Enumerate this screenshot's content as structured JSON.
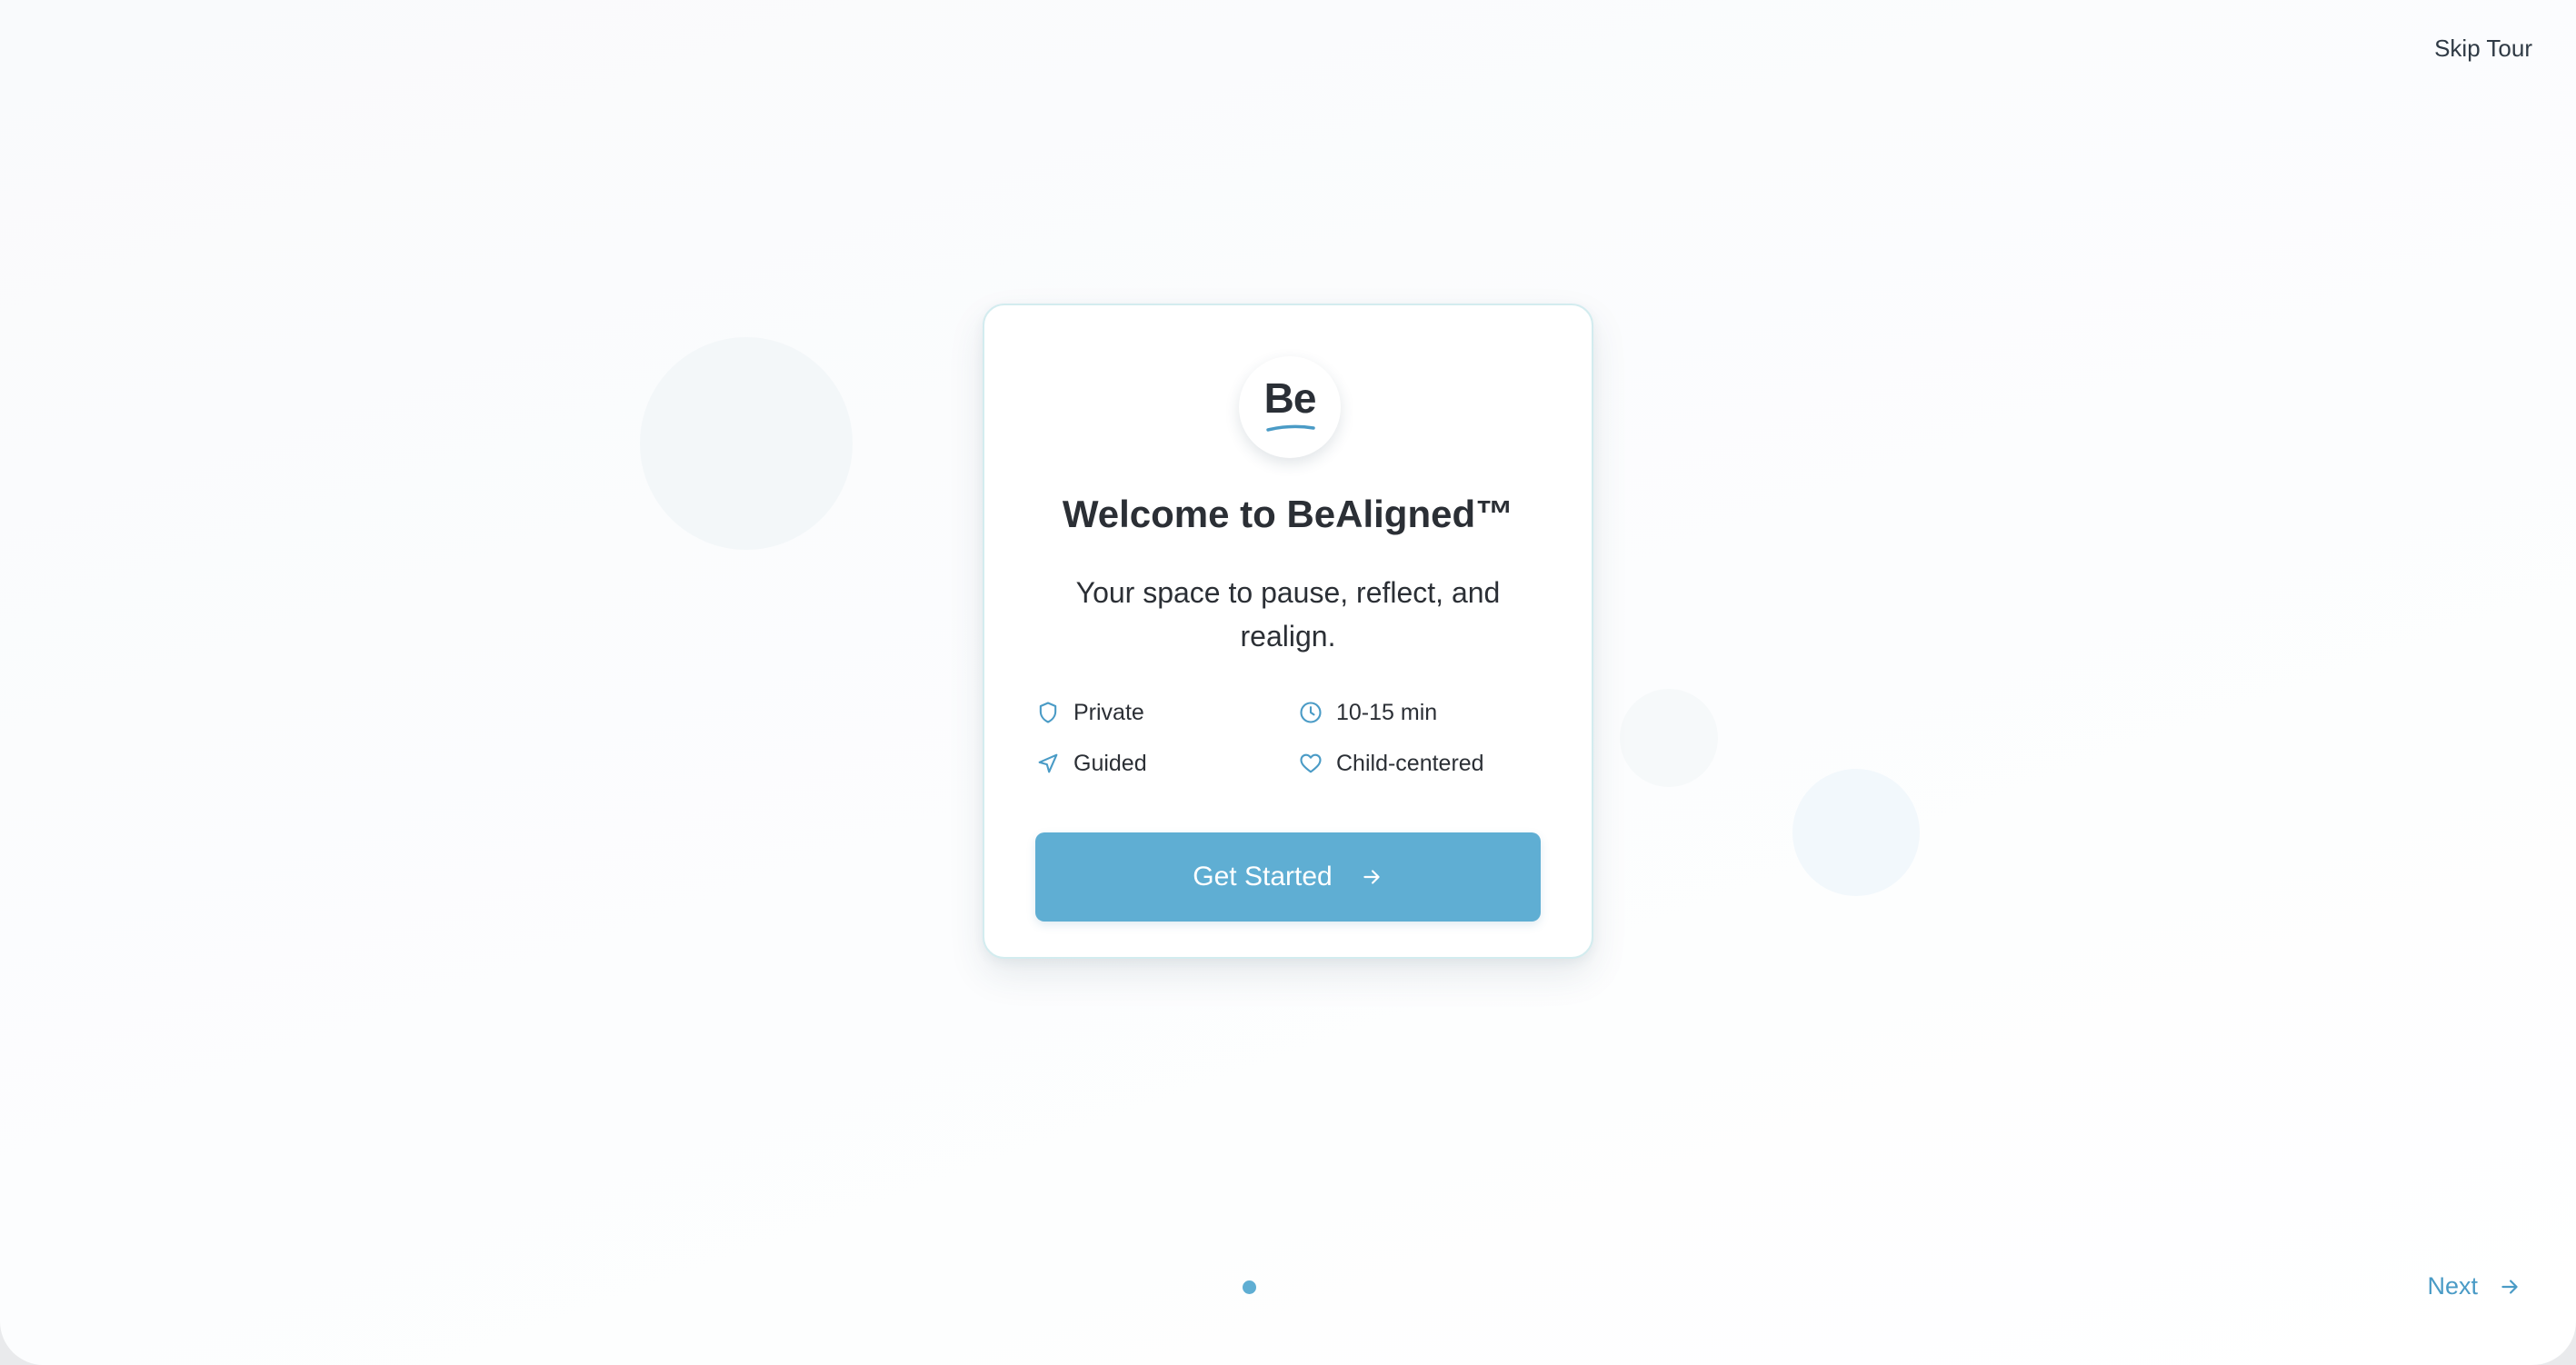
{
  "header": {
    "skip_label": "Skip Tour"
  },
  "card": {
    "logo_text": "Be",
    "title": "Welcome to BeAligned™",
    "subtitle": "Your space to pause, reflect, and realign.",
    "features": [
      {
        "label": "Private",
        "icon": "shield-icon"
      },
      {
        "label": "10-15 min",
        "icon": "clock-icon"
      },
      {
        "label": "Guided",
        "icon": "navigation-arrow-icon"
      },
      {
        "label": "Child-centered",
        "icon": "heart-icon"
      }
    ],
    "cta_label": "Get Started"
  },
  "footer": {
    "current_step": 1,
    "total_steps": 1,
    "next_label": "Next"
  },
  "colors": {
    "accent": "#5faed3",
    "next_text": "#4a9bc6",
    "icon": "#4a9bc6",
    "text": "#2b2f35",
    "card_border": "#d3ecef"
  }
}
